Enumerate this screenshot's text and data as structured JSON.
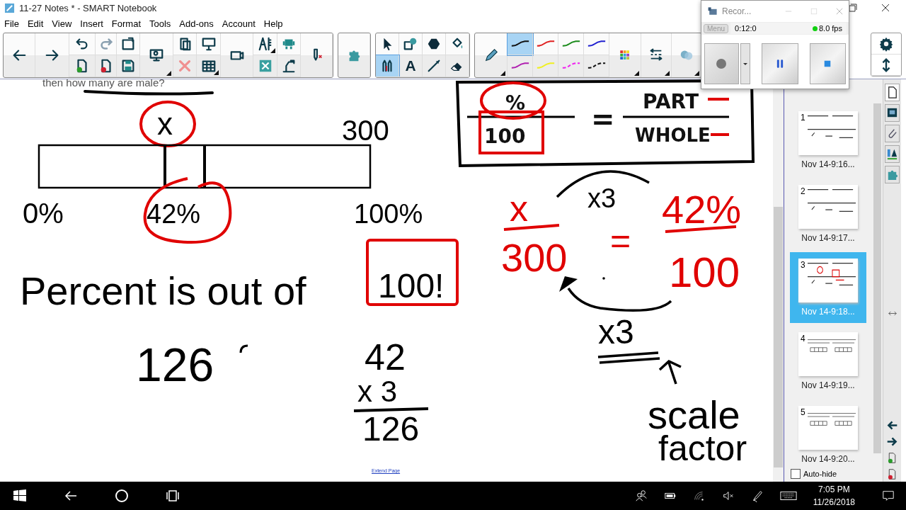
{
  "window": {
    "title": "11-27 Notes * - SMART Notebook"
  },
  "menu": [
    "File",
    "Edit",
    "View",
    "Insert",
    "Format",
    "Tools",
    "Add-ons",
    "Account",
    "Help"
  ],
  "tools": [
    {
      "selected": false
    },
    {
      "selected": false
    },
    {
      "selected": false
    },
    {
      "selected": false
    },
    {
      "selected": true
    },
    {
      "selected": false,
      "glyph": "A"
    },
    {
      "selected": false
    },
    {
      "selected": false
    }
  ],
  "pen_styles": [
    {
      "color": "#111111",
      "kind": "line",
      "selected": true
    },
    {
      "color": "#e02020",
      "kind": "line",
      "selected": false
    },
    {
      "color": "#1a8a1a",
      "kind": "line",
      "selected": false
    },
    {
      "color": "#2020d0",
      "kind": "line",
      "selected": false
    },
    {
      "color": "#b020b0",
      "kind": "line",
      "selected": false
    },
    {
      "color": "#f0f020",
      "kind": "line",
      "selected": false
    },
    {
      "color": "#f020f0",
      "kind": "dash",
      "selected": false
    },
    {
      "color": "#111111",
      "kind": "dash",
      "selected": false
    }
  ],
  "recorder": {
    "title": "Recor...",
    "menu": "Menu",
    "time": "0:12:0",
    "fps": "8.0 fps"
  },
  "canvas": {
    "ink": [
      {
        "text": "then how many are male?",
        "color": "#555555",
        "kind": "note"
      },
      {
        "text": "x",
        "color": "#000000",
        "kind": "ink"
      },
      {
        "text": "300",
        "color": "#000000",
        "kind": "ink"
      },
      {
        "text": "0%",
        "color": "#000000",
        "kind": "ink"
      },
      {
        "text": "42%",
        "color": "#000000",
        "kind": "ink"
      },
      {
        "text": "100%",
        "color": "#000000",
        "kind": "ink"
      },
      {
        "text": "Percent is out of",
        "color": "#000000",
        "kind": "ink"
      },
      {
        "text": "100!",
        "color": "#000000",
        "kind": "ink"
      },
      {
        "text": "126",
        "color": "#000000",
        "kind": "ink"
      },
      {
        "text": "42",
        "color": "#000000",
        "kind": "ink"
      },
      {
        "text": "x 3",
        "color": "#000000",
        "kind": "ink"
      },
      {
        "text": "126",
        "color": "#000000",
        "kind": "ink"
      },
      {
        "text": "%",
        "color": "#111111",
        "kind": "printed"
      },
      {
        "text": "100",
        "color": "#111111",
        "kind": "printed"
      },
      {
        "text": "=",
        "color": "#111111",
        "kind": "printed"
      },
      {
        "text": "PART",
        "color": "#111111",
        "kind": "printed"
      },
      {
        "text": "WHOLE",
        "color": "#111111",
        "kind": "printed"
      },
      {
        "text": "x",
        "color": "#e00000",
        "kind": "ink"
      },
      {
        "text": "300",
        "color": "#e00000",
        "kind": "ink"
      },
      {
        "text": "=",
        "color": "#e00000",
        "kind": "ink"
      },
      {
        "text": "42%",
        "color": "#e00000",
        "kind": "ink"
      },
      {
        "text": "100",
        "color": "#e00000",
        "kind": "ink"
      },
      {
        "text": "x3",
        "color": "#000000",
        "kind": "ink"
      },
      {
        "text": "x3",
        "color": "#000000",
        "kind": "ink"
      },
      {
        "text": "scale",
        "color": "#000000",
        "kind": "ink"
      },
      {
        "text": "factor",
        "color": "#000000",
        "kind": "ink"
      }
    ],
    "link": "Extend Page"
  },
  "pages": [
    {
      "number": "1",
      "label": "Nov 14-9:16...",
      "selected": false
    },
    {
      "number": "2",
      "label": "Nov 14-9:17...",
      "selected": false
    },
    {
      "number": "3",
      "label": "Nov 14-9:18...",
      "selected": true
    },
    {
      "number": "4",
      "label": "Nov 14-9:19...",
      "selected": false
    },
    {
      "number": "5",
      "label": "Nov 14-9:20...",
      "selected": false
    }
  ],
  "auto_hide": {
    "label": "Auto-hide",
    "checked": false
  },
  "taskbar": {
    "time": "7:05 PM",
    "date": "11/26/2018"
  }
}
